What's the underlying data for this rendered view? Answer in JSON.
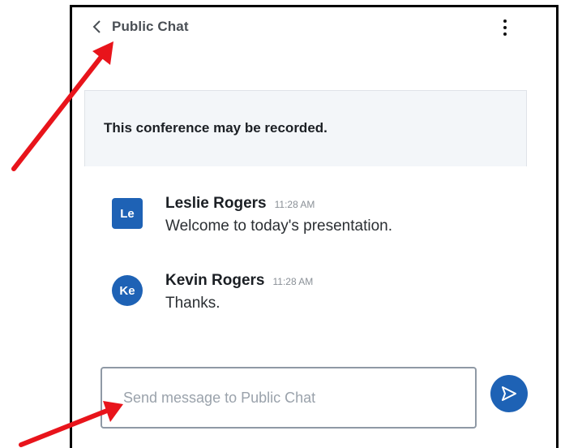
{
  "header": {
    "back_icon": "chevron-left-icon",
    "title": "Public Chat",
    "menu_icon": "more-vertical-icon"
  },
  "notice": {
    "text": "This conference may be recorded."
  },
  "messages": [
    {
      "avatar_initials": "Le",
      "avatar_shape": "square",
      "sender": "Leslie Rogers",
      "time": "11:28 AM",
      "text": "Welcome to today's presentation."
    },
    {
      "avatar_initials": "Ke",
      "avatar_shape": "round",
      "sender": "Kevin Rogers",
      "time": "11:28 AM",
      "text": "Thanks."
    }
  ],
  "composer": {
    "placeholder": "Send message to Public Chat",
    "value": "",
    "send_icon": "send-icon"
  },
  "colors": {
    "accent": "#1e62b5",
    "annotation_arrow": "#e8141b"
  },
  "annotations": {
    "arrow_icon": "red-arrow-icon",
    "count": 2
  }
}
